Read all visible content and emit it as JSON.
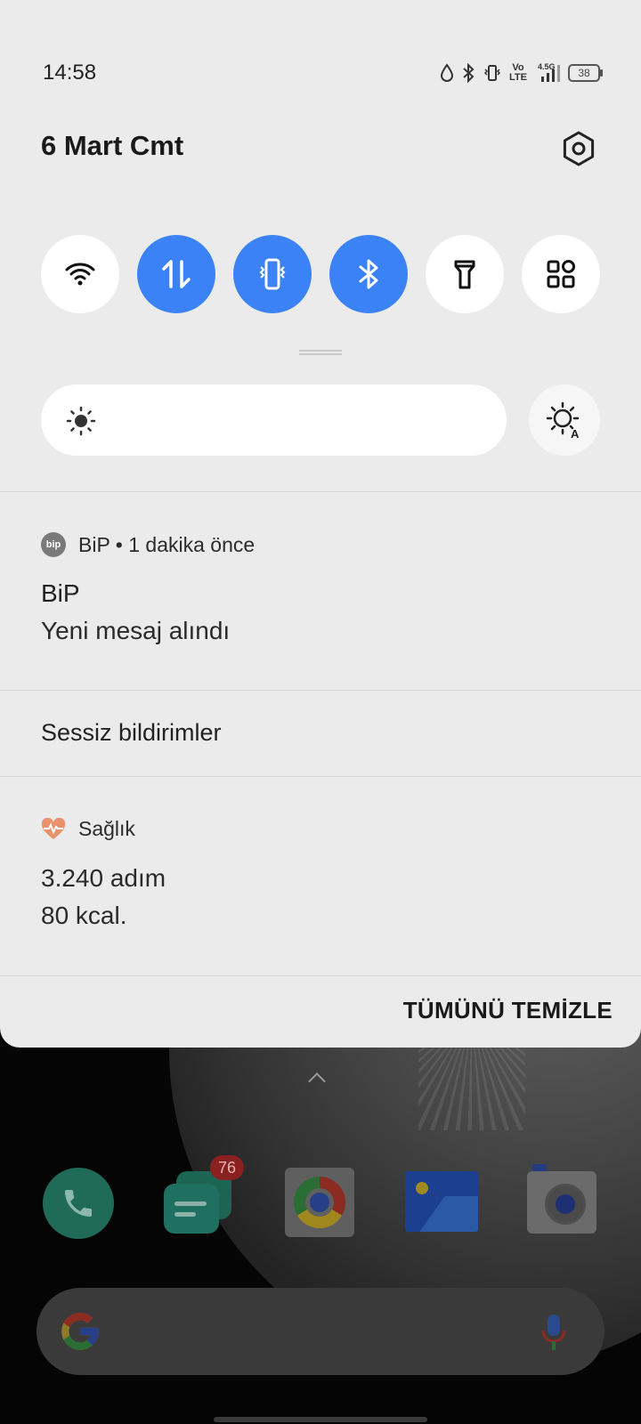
{
  "status_bar": {
    "time": "14:58",
    "icons": [
      "water-drop-icon",
      "bluetooth-icon",
      "vibrate-icon",
      "volte-icon",
      "signal-4g-icon",
      "battery-icon"
    ],
    "volte_line1": "Vo",
    "volte_line2": "LTE",
    "network_label": "4.5G",
    "battery_level": "38"
  },
  "header": {
    "date": "6 Mart Cmt"
  },
  "quick_tiles": [
    {
      "name": "wifi",
      "active": false
    },
    {
      "name": "mobile-data",
      "active": true
    },
    {
      "name": "vibrate",
      "active": true
    },
    {
      "name": "bluetooth",
      "active": true
    },
    {
      "name": "flashlight",
      "active": false
    },
    {
      "name": "more-tiles",
      "active": false
    }
  ],
  "accent_color": "#3b82f6",
  "notifications": [
    {
      "app_icon_text": "bip",
      "app": "BiP",
      "time": "1 dakika önce",
      "title": "BiP",
      "text": "Yeni mesaj alındı"
    }
  ],
  "silent_section": {
    "label": "Sessiz bildirimler",
    "notification": {
      "app": "Sağlık",
      "line1": "3.240 adım",
      "line2": "80 kcal."
    }
  },
  "actions": {
    "clear_all": "TÜMÜNÜ TEMİZLE"
  },
  "home_screen": {
    "dock": [
      "phone-app",
      "messages-app",
      "chrome-app",
      "gallery-app",
      "camera-app"
    ],
    "messages_badge": "76"
  }
}
